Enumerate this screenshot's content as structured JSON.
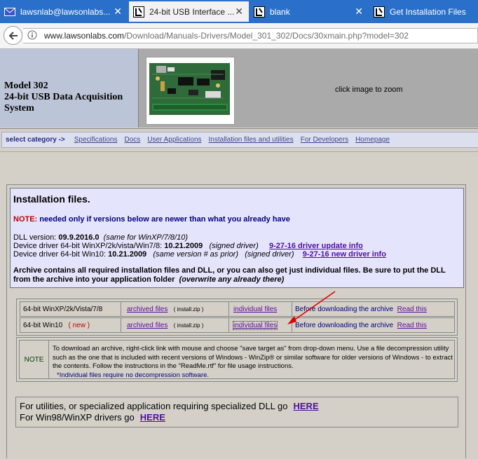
{
  "tabs": [
    {
      "label": "lawsnlab@lawsonlabs...",
      "icon": "mail-icon",
      "active": false
    },
    {
      "label": "24-bit USB Interface ...",
      "icon": "lawson-icon",
      "active": true
    },
    {
      "label": "blank",
      "icon": "lawson-icon",
      "active": false
    },
    {
      "label": "Get Installation Files",
      "icon": "lawson-icon",
      "active": false
    }
  ],
  "urlbar": {
    "host": "www.lawsonlabs.com",
    "path": "/Download/Manuals-Drivers/Model_301_302/Docs/30xmain.php?model=302"
  },
  "header": {
    "line1": "Model 302",
    "line2": "24-bit USB Data Acquisition",
    "line3": "System",
    "zoom_hint": "click image to zoom"
  },
  "nav": {
    "label": "select category  ->",
    "links": [
      "Specifications",
      "Docs",
      "User Applications",
      "Installation files and utilities",
      "For Developers",
      "Homepage"
    ]
  },
  "install": {
    "heading": "Installation files.",
    "note_label": "NOTE:",
    "note_text": "needed only if versions below are newer than what you already have",
    "dll_label": "DLL version:",
    "dll_version": "09.9.2016.0",
    "dll_note": "(same for WinXP/7/8/10)",
    "drv1_label": "Device driver 64-bit WinXP/2k/vista/Win7/8:",
    "drv1_version": "10.21.2009",
    "drv1_note": "(signed driver)",
    "drv1_link": "9-27-16 driver update info",
    "drv2_label": "Device driver 64-bit Win10:",
    "drv2_version": "10.21.2009",
    "drv2_note": "(same version # as prior)",
    "drv2_note2": "(signed driver)",
    "drv2_link": "9-27-16 new driver info",
    "archive_text": "Archive contains all required installation files and DLL, or you can also get just individual files. Be sure to put the DLL from the archive into your application folder",
    "archive_em": "(overwrite any already there)"
  },
  "rows": [
    {
      "os": "64-bit  WinXP/2k/Vista/7/8",
      "new": "",
      "archived": "archived files",
      "zip": "( install.zip )",
      "individual": "individual files",
      "before": "Before downloading the archive",
      "read": "Read this"
    },
    {
      "os": "64-bit  Win10",
      "new": "( new )",
      "archived": "archived files",
      "zip": "( install.zip )",
      "individual": "individual files",
      "before": "Before downloading the archive",
      "read": "Read this"
    }
  ],
  "note": {
    "label": "NOTE",
    "text": "To download an archive, right-click link with mouse and choose \"save target as\" from drop-down menu. Use a file decompression utility such as the one that is included with recent versions of Windows - WinZip® or similar software for older versions of Windows -  to extract the contents. Follow the instructions in the \"ReadMe.rtf\" for file usage instructions.",
    "footnote": "*Individual files require no decompression software."
  },
  "utilities": {
    "line1": "For utilities, or specialized application requiring specialized DLL go",
    "line1_link": "HERE",
    "line2": "For Win98/WinXP drivers go",
    "line2_link": "HERE"
  },
  "colors": {
    "tabbar": "#2a6fc9",
    "link": "#5010a0",
    "note_red": "#c00000",
    "arrow": "#e00000"
  }
}
